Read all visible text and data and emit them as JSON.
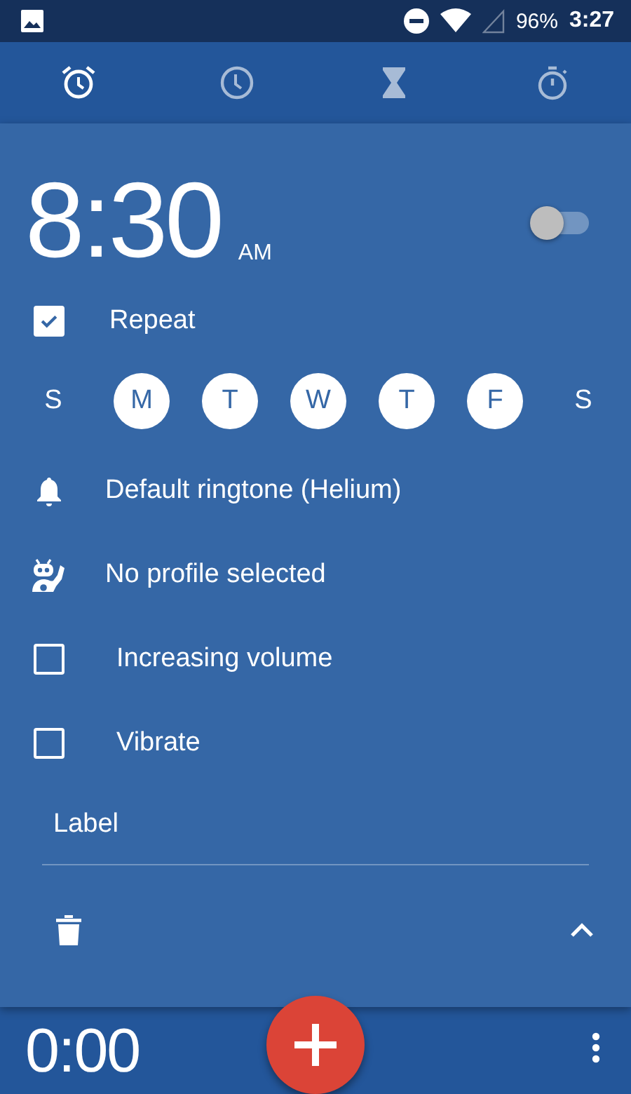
{
  "status_bar": {
    "battery": "96%",
    "time": "3:27"
  },
  "tabs": [
    {
      "kind": "alarm",
      "selected": true
    },
    {
      "kind": "clock",
      "selected": false
    },
    {
      "kind": "timer",
      "selected": false
    },
    {
      "kind": "stopwatch",
      "selected": false
    }
  ],
  "alarm": {
    "time": "8:30",
    "meridiem": "AM",
    "on": false,
    "expanded": true,
    "repeat": {
      "label": "Repeat",
      "checked": true
    },
    "days": [
      {
        "letter": "S",
        "selected": false
      },
      {
        "letter": "M",
        "selected": true
      },
      {
        "letter": "T",
        "selected": true
      },
      {
        "letter": "W",
        "selected": true
      },
      {
        "letter": "T",
        "selected": true
      },
      {
        "letter": "F",
        "selected": true
      },
      {
        "letter": "S",
        "selected": false
      }
    ],
    "ringtone": "Default ringtone (Helium)",
    "profile": "No profile selected",
    "options": [
      {
        "label": "Increasing volume",
        "checked": false
      },
      {
        "label": "Vibrate",
        "checked": false
      }
    ],
    "label": "Label"
  },
  "next_alarm": {
    "time": "0:00"
  }
}
